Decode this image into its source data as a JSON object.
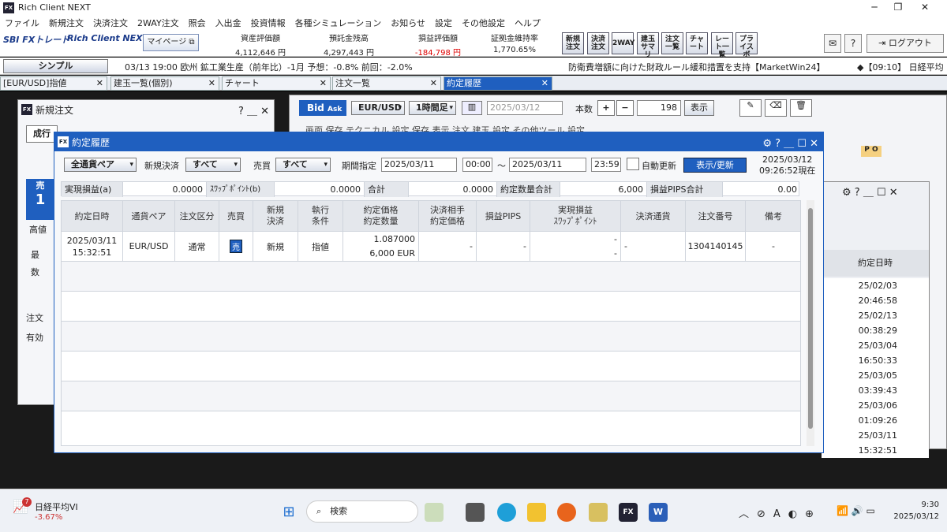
{
  "app": {
    "title": "Rich Client NEXT",
    "logo": "FX",
    "minimize": "─",
    "maximize": "❐",
    "close": "✕"
  },
  "menu": [
    "ファイル",
    "新規注文",
    "決済注文",
    "2WAY注文",
    "照会",
    "入出金",
    "投資情報",
    "各種シミュレーション",
    "お知らせ",
    "設定",
    "その他設定",
    "ヘルプ"
  ],
  "brand": {
    "sbi": "SBI FXトレード",
    "rc": "Rich Client NEXT",
    "mypage": "マイページ ⧉"
  },
  "stats": [
    {
      "label": "資産評価額",
      "value": "4,112,646 円",
      "neg": false
    },
    {
      "label": "預託金残高",
      "value": "4,297,443 円",
      "neg": false
    },
    {
      "label": "損益評価額",
      "value": "-184,798 円",
      "neg": true
    },
    {
      "label": "証拠金維持率",
      "value": "1,770.65%",
      "neg": false
    }
  ],
  "toolbar": [
    "新規注文",
    "決済注文",
    "2WAY",
    "建玉サマリ",
    "注文一覧",
    "チャート",
    "レート一覧",
    "プライスボ"
  ],
  "logout": "ログアウト",
  "ticker": {
    "mode": "シンプル",
    "news": "03/13 19:00 欧州 鉱工業生産（前年比）-1月 予想：-0.8% 前回：-2.0%",
    "news2": "防衛費増額に向けた財政ルール緩和措置を支持【MarketWin24】",
    "news3": "◆【09:10】 日経平均"
  },
  "tabs": [
    "[EUR/USD]指値",
    "建玉一覧(個別)",
    "チャート",
    "注文一覧",
    "約定履歴"
  ],
  "chartbar": {
    "bid": "Bid",
    "ask": "Ask",
    "pair": "EUR/USD",
    "tf": "1時間足",
    "date": "2025/03/12",
    "qty_label": "本数",
    "qty": "198",
    "show": "表示",
    "plus": "+",
    "minus": "−"
  },
  "chartbar2": [
    "画面",
    "保存",
    "テクニカル",
    "設定",
    "保存",
    "表示",
    "注文",
    "建玉",
    "設定",
    "その他ツール",
    "設定"
  ],
  "neworder": {
    "title": "新規注文",
    "help": "?",
    "tab1": "成行",
    "side": "売",
    "qty": "1",
    "l1": "高値",
    "l2": "最",
    "l3": "数",
    "l4": "注文",
    "l5": "有効"
  },
  "history": {
    "title": "約定履歴",
    "pair_filter": "全通貨ペア",
    "type_label": "新規決済",
    "type_value": "すべて",
    "side_label": "売買",
    "side_value": "すべて",
    "period_label": "期間指定",
    "from_date": "2025/03/11",
    "from_time": "00:00",
    "tilde": "～",
    "to_date": "2025/03/11",
    "to_time": "23:59",
    "auto_label": "自動更新",
    "refresh": "表示/更新",
    "asof_date": "2025/03/12",
    "asof_time": "09:26:52現在",
    "summary": [
      {
        "label": "実現損益(a)",
        "value": "0.0000"
      },
      {
        "label": "ｽﾜｯﾌﾟﾎﾟｲﾝﾄ(b)",
        "value": "0.0000"
      },
      {
        "label": "合計(a+b)",
        "value": "0.0000"
      },
      {
        "label": "約定数量合計",
        "value": "6,000"
      },
      {
        "label": "損益PIPS合計",
        "value": "0.00"
      }
    ],
    "headers": [
      "約定日時",
      "通貨ペア",
      "注文区分",
      "売買",
      "新規\n決済",
      "執行\n条件",
      "約定価格\n約定数量",
      "決済相手\n約定価格",
      "損益PIPS",
      "実現損益\nｽﾜｯﾌﾟﾎﾟｲﾝﾄ",
      "決済通貨",
      "注文番号",
      "備考"
    ],
    "row": {
      "date": "2025/03/11",
      "time": "15:32:51",
      "pair": "EUR/USD",
      "kind": "通常",
      "side": "売",
      "newclose": "新規",
      "cond": "指値",
      "price": "1.087000",
      "qty": "6,000 EUR",
      "opp": "-",
      "pips": "-",
      "pl": "-",
      "swap": "-",
      "ccy": "-",
      "orderno": "1304140145",
      "note": "-"
    }
  },
  "rightpanel": {
    "header": "約定日時",
    "rows": [
      "25/02/03 20:46:58",
      "25/02/13 00:38:29",
      "25/03/04 16:50:33",
      "25/03/05 03:39:43",
      "25/03/06 01:09:26",
      "25/03/11 15:32:51"
    ]
  },
  "taskbar": {
    "nikkei": "日経平均VI",
    "nikkei_chg": "-3.67%",
    "search": "検索",
    "time": "9:30",
    "date": "2025/03/12",
    "badge": "7"
  }
}
